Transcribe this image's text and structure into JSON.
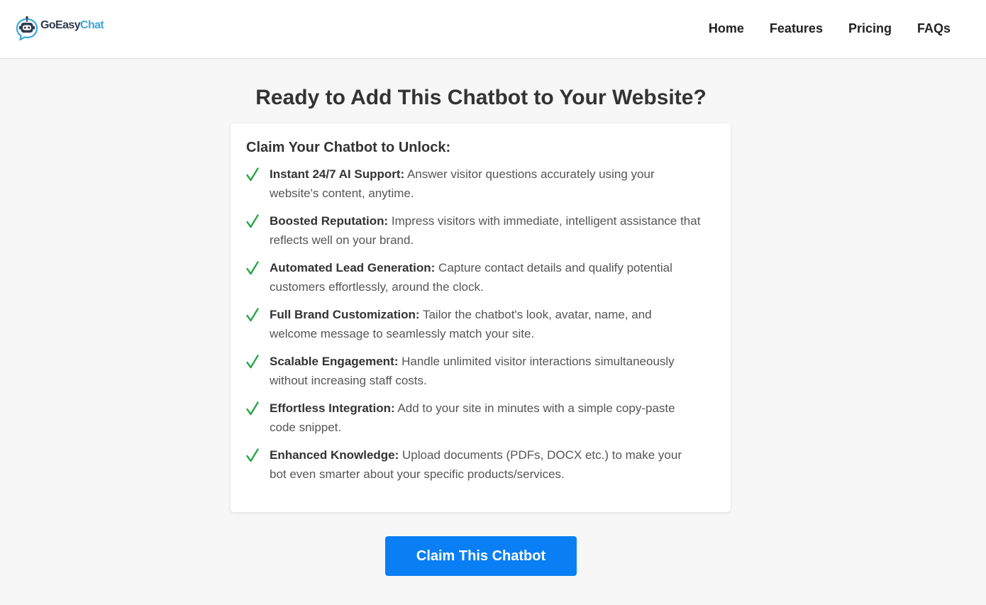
{
  "brand": {
    "name_part1": "GoEasy",
    "name_part2": "Chat",
    "accent_color": "#3ba7d8",
    "dark_color": "#2e3b4e"
  },
  "nav": {
    "items": [
      {
        "label": "Home"
      },
      {
        "label": "Features"
      },
      {
        "label": "Pricing"
      },
      {
        "label": "FAQs"
      }
    ]
  },
  "main": {
    "headline": "Ready to Add This Chatbot to Your Website?",
    "card": {
      "title": "Claim Your Chatbot to Unlock:",
      "check_color": "#28a745",
      "benefits": [
        {
          "title": "Instant 24/7 AI Support:",
          "text": " Answer visitor questions accurately using your website's content, anytime."
        },
        {
          "title": "Boosted Reputation:",
          "text": " Impress visitors with immediate, intelligent assistance that reflects well on your brand."
        },
        {
          "title": "Automated Lead Generation:",
          "text": " Capture contact details and qualify potential customers effortlessly, around the clock."
        },
        {
          "title": "Full Brand Customization:",
          "text": " Tailor the chatbot's look, avatar, name, and welcome message to seamlessly match your site."
        },
        {
          "title": "Scalable Engagement:",
          "text": " Handle unlimited visitor interactions simultaneously without increasing staff costs."
        },
        {
          "title": "Effortless Integration:",
          "text": " Add to your site in minutes with a simple copy-paste code snippet."
        },
        {
          "title": "Enhanced Knowledge:",
          "text": " Upload documents (PDFs, DOCX etc.) to make your bot even smarter about your specific products/services."
        }
      ]
    },
    "cta_label": "Claim This Chatbot",
    "cta_color": "#0a7ff5"
  }
}
